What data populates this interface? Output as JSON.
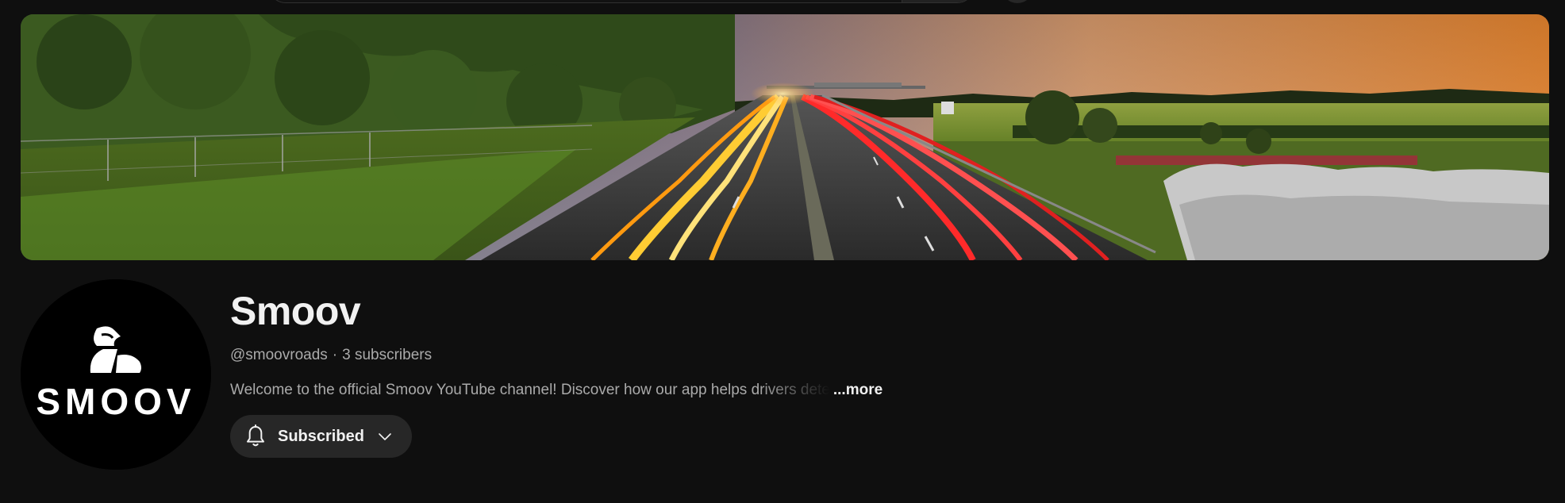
{
  "channel": {
    "name": "Smoov",
    "handle": "@smoovroads",
    "separator": "·",
    "subscribers": "3 subscribers",
    "description": "Welcome to the official Smoov YouTube channel! Discover how our app helps drivers dete",
    "more_label": "...more",
    "avatar_text": "SMOOV"
  },
  "subscribe_button": {
    "label": "Subscribed",
    "icon": "bell-icon",
    "dropdown_icon": "chevron-down-icon"
  },
  "banner": {
    "icon": "highway-light-trails-image"
  },
  "colors": {
    "background": "#0f0f0f",
    "primary_text": "#f1f1f1",
    "secondary_text": "#aaaaaa",
    "button_bg": "#272727"
  }
}
